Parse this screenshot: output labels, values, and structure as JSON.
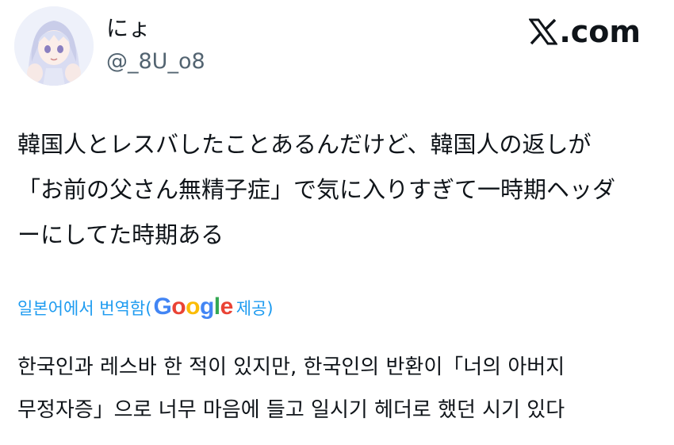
{
  "user": {
    "display_name": "にょ",
    "handle": "@_8U_o8",
    "avatar_icon": "anime-avatar-icon"
  },
  "brand": {
    "label": ".com",
    "logo_icon": "x-logo-icon"
  },
  "tweet": {
    "lines": [
      "韓国人とレスバしたことあるんだけど、韓国人の返しが",
      "「お前の父さん無精子症」で気に入りすぎて一時期ヘッダ",
      "ーにしてた時期ある"
    ]
  },
  "translation": {
    "label": "일본어에서 번역함(",
    "google_letters": [
      "G",
      "o",
      "o",
      "g",
      "l",
      "e"
    ],
    "provided": " 제공)",
    "lines": [
      "한국인과 레스바 한 적이 있지만, 한국인의 반환이「너의 아버지",
      "무정자증」으로 너무 마음에 들고 일시기 헤더로 했던 시기 있다"
    ]
  },
  "colors": {
    "link": "#1d9bf0",
    "secondary_text": "#536471",
    "google_blue": "#4285f4",
    "google_red": "#ea4335",
    "google_yellow": "#fbbc05",
    "google_green": "#34a853"
  }
}
